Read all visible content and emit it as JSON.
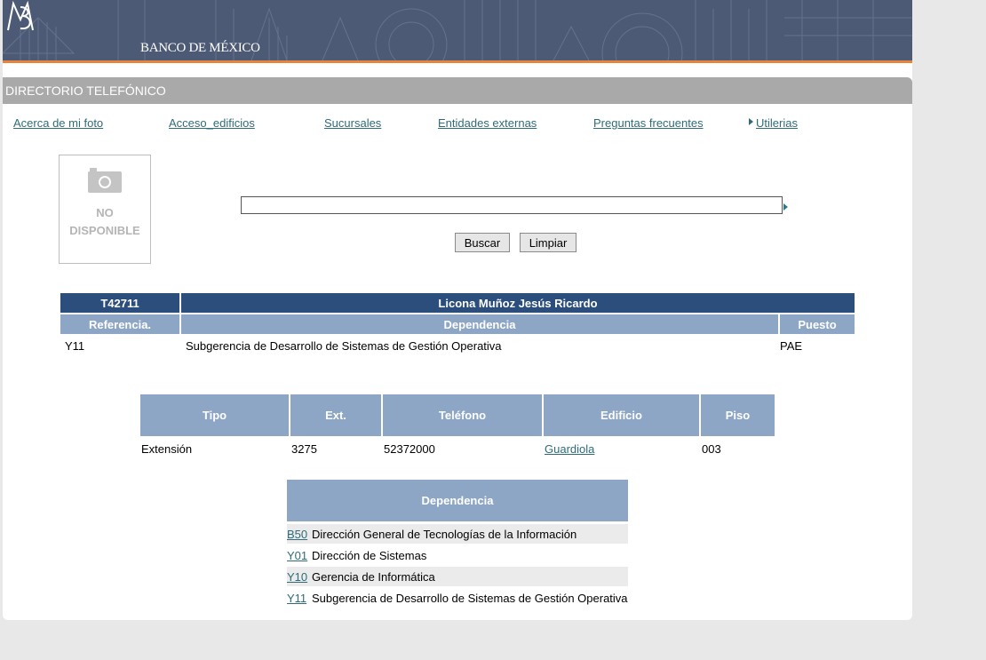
{
  "header": {
    "logo_text": "BANCO DE MÉXICO",
    "title": "DIRECTORIO TELEFÓNICO"
  },
  "nav": {
    "items": [
      {
        "label": "Acerca de mi foto"
      },
      {
        "label": "Acceso_edificios"
      },
      {
        "label": "Sucursales"
      },
      {
        "label": "Entidades externas"
      },
      {
        "label": "Preguntas frecuentes"
      },
      {
        "label": "Utilerias"
      }
    ]
  },
  "photo": {
    "line1": "NO",
    "line2": "DISPONIBLE"
  },
  "search": {
    "value": "",
    "buscar_label": "Buscar",
    "limpiar_label": "Limpiar"
  },
  "employee": {
    "id": "T42711",
    "name": "Licona Muñoz Jesús Ricardo",
    "headers": {
      "referencia": "Referencia.",
      "dependencia": "Dependencia",
      "puesto": "Puesto"
    },
    "referencia": "Y11",
    "dependencia": "Subgerencia de Desarrollo de Sistemas de Gestión Operativa",
    "puesto": "PAE"
  },
  "phones": {
    "headers": {
      "tipo": "Tipo",
      "ext": "Ext.",
      "telefono": "Teléfono",
      "edificio": "Edificio",
      "piso": "Piso"
    },
    "row": {
      "tipo": "Extensión",
      "ext": "3275",
      "telefono": "52372000",
      "edificio": "Guardiola",
      "piso": "003"
    }
  },
  "dependencias": {
    "header": "Dependencia",
    "rows": [
      {
        "code": "B50",
        "name": "Dirección General de Tecnologías de la Información"
      },
      {
        "code": "Y01",
        "name": "Dirección de Sistemas"
      },
      {
        "code": "Y10",
        "name": "Gerencia de Informática"
      },
      {
        "code": "Y11",
        "name": "Subgerencia de Desarrollo de Sistemas de Gestión Operativa"
      }
    ]
  },
  "colors": {
    "header_dark": "#2c4e7c",
    "header_light": "#8ea6c6",
    "link": "#2f6b78",
    "banner_accent": "#e8843a"
  }
}
